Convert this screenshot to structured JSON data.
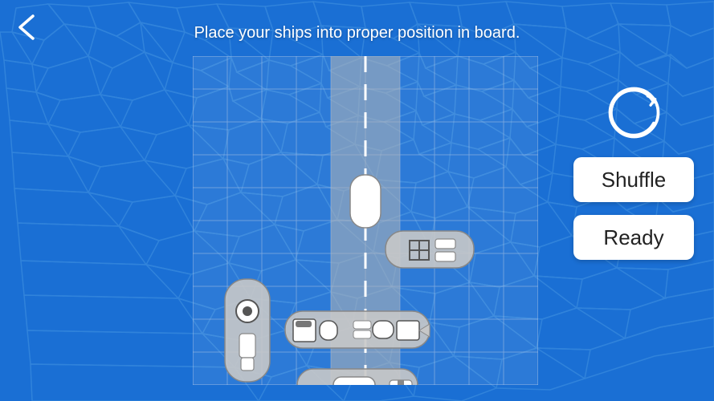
{
  "header": {
    "instruction": "Place your ships into proper position in board."
  },
  "buttons": {
    "back_label": "‹",
    "shuffle_label": "Shuffle",
    "ready_label": "Ready"
  },
  "board": {
    "cols": 10,
    "rows": 10
  }
}
